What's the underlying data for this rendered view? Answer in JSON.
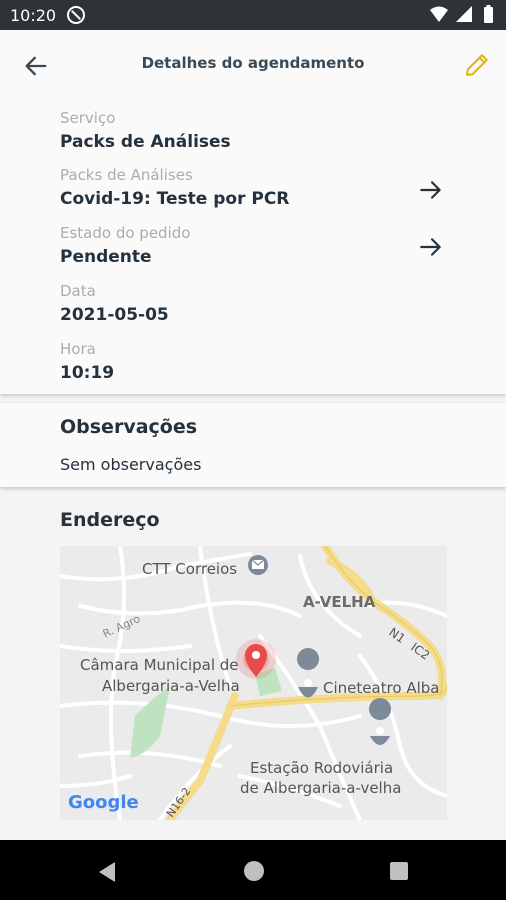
{
  "status_bar": {
    "time": "10:20"
  },
  "header": {
    "title": "Detalhes do agendamento"
  },
  "details": {
    "servico_label": "Serviço",
    "servico_value": "Packs de Análises",
    "packs_label": "Packs de Análises",
    "packs_value": "Covid-19: Teste por PCR",
    "estado_label": "Estado do pedido",
    "estado_value": "Pendente",
    "data_label": "Data",
    "data_value": "2021-05-05",
    "hora_label": "Hora",
    "hora_value": "10:19"
  },
  "observacoes": {
    "title": "Observações",
    "text": "Sem observações"
  },
  "endereco": {
    "title": "Endereço",
    "map_labels": {
      "ctt": "CTT Correios",
      "town": "A-VELHA",
      "road_agro": "R. Agro",
      "road_n1": "N1",
      "road_ic2": "IC2",
      "camara_1": "Câmara Municipal de",
      "camara_2": "Albergaria-a-Velha",
      "cineteatro": "Cineteatro Alba",
      "estacao_1": "Estação Rodoviária",
      "estacao_2": "de Albergaria-a-velha",
      "road_n162": "N16-2",
      "google": "Google"
    }
  },
  "colors": {
    "accent_edit": "#e3b400",
    "status_bar": "#2e3338",
    "pin": "#e94b4b"
  }
}
